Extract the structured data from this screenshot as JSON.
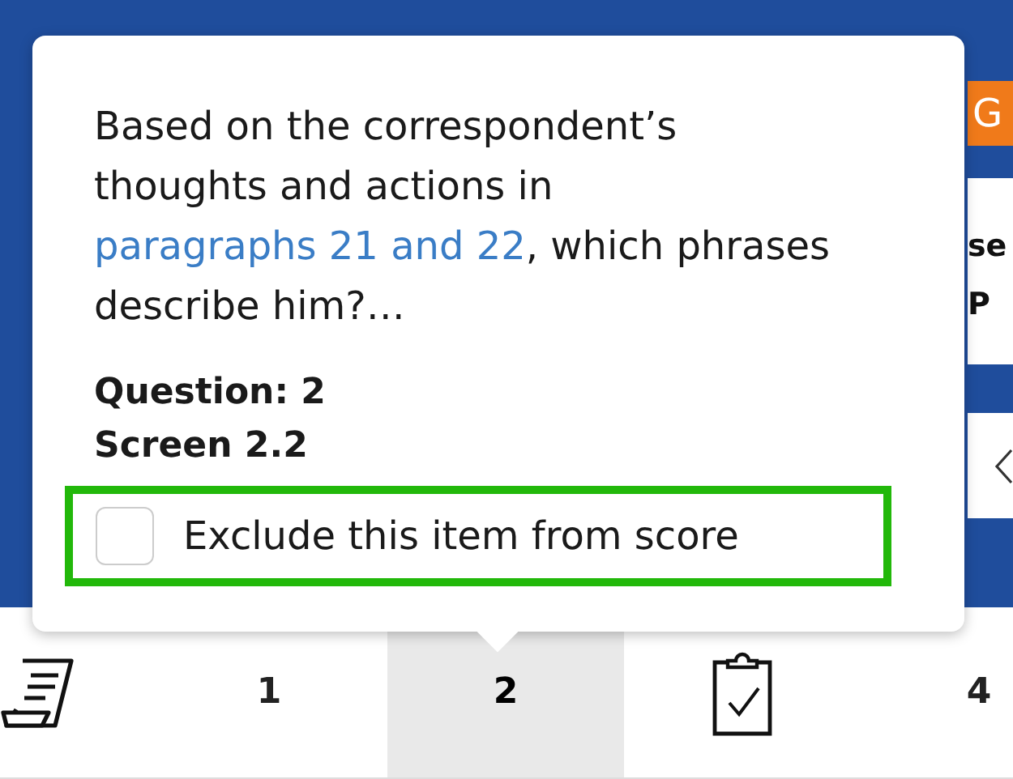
{
  "background": {
    "go_button": {
      "label": "G"
    },
    "side_panel": {
      "texts": [
        "se",
        "P"
      ]
    }
  },
  "popover": {
    "prompt_before": "Based on the correspondent’s thoughts and actions in ",
    "link": "paragraphs 21 and 22",
    "prompt_after": ", which phrases describe him?…",
    "question": "Question: 2",
    "screen": "Screen 2.2",
    "exclude": {
      "label": "Exclude this item from score",
      "checked": false,
      "highlighted": true
    }
  },
  "nav": [
    {
      "kind": "notes",
      "selected": false
    },
    {
      "kind": "number",
      "label": "1",
      "selected": false
    },
    {
      "kind": "number",
      "label": "2",
      "selected": true
    },
    {
      "kind": "clipboard",
      "selected": false
    },
    {
      "kind": "number",
      "label": "4",
      "selected": false
    }
  ]
}
